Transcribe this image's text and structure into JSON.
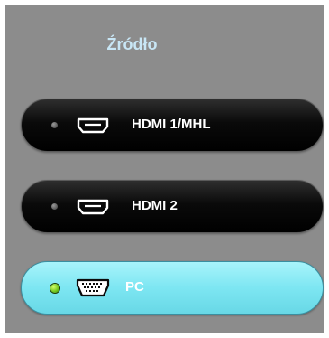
{
  "menu": {
    "title": "Źródło",
    "items": [
      {
        "label": "HDMI 1/MHL",
        "icon": "hdmi-icon",
        "selected": false
      },
      {
        "label": "HDMI 2",
        "icon": "hdmi-icon",
        "selected": false
      },
      {
        "label": "PC",
        "icon": "vga-icon",
        "selected": true
      }
    ]
  },
  "colors": {
    "panel_bg": "#8c8c8c",
    "title": "#c8e6f5",
    "button_dark": "#000000",
    "button_selected": "#7de6f2",
    "led_active": "#6cc21a",
    "led_inactive": "#666666"
  }
}
